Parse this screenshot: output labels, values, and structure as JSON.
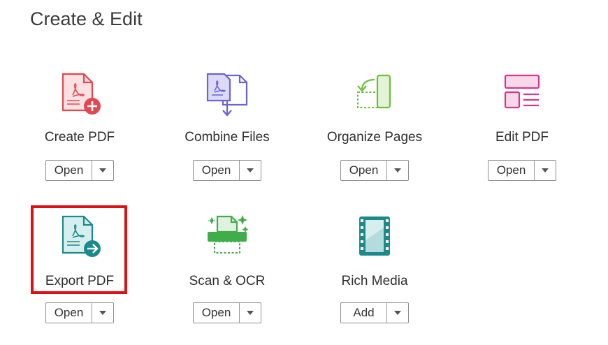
{
  "section": {
    "title": "Create & Edit"
  },
  "tools": [
    {
      "label": "Create PDF",
      "button": "Open",
      "icon": "create-pdf-icon",
      "color": "#e34850"
    },
    {
      "label": "Combine Files",
      "button": "Open",
      "icon": "combine-files-icon",
      "color": "#6e62d9"
    },
    {
      "label": "Organize Pages",
      "button": "Open",
      "icon": "organize-pages-icon",
      "color": "#6cbf3b"
    },
    {
      "label": "Edit PDF",
      "button": "Open",
      "icon": "edit-pdf-icon",
      "color": "#d83790"
    },
    {
      "label": "Export PDF",
      "button": "Open",
      "icon": "export-pdf-icon",
      "color": "#1c8a8a"
    },
    {
      "label": "Scan & OCR",
      "button": "Open",
      "icon": "scan-ocr-icon",
      "color": "#3fae49"
    },
    {
      "label": "Rich Media",
      "button": "Add",
      "icon": "rich-media-icon",
      "color": "#1c8a8a"
    }
  ],
  "highlight_color": "#e01010"
}
